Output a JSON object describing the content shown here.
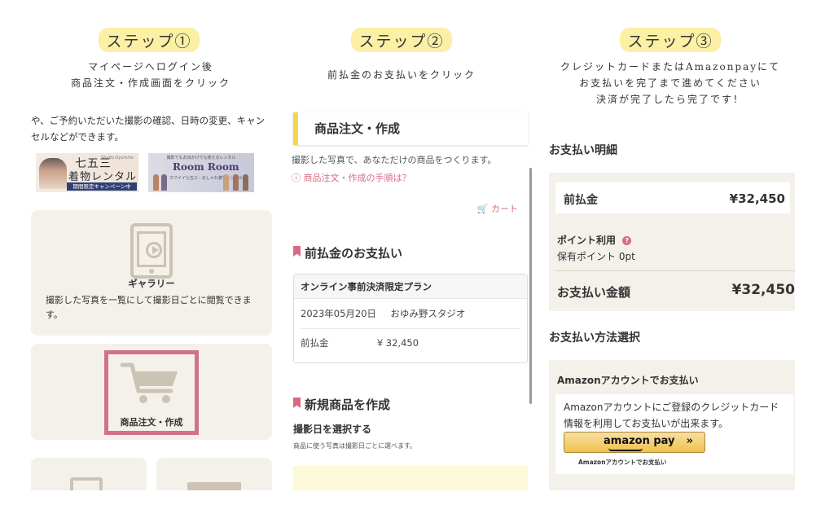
{
  "steps": [
    {
      "badge": "ステップ①",
      "note_lines": [
        "マイページへログイン後",
        "商品注文・作成画面をクリック"
      ]
    },
    {
      "badge": "ステップ②",
      "note_lines": [
        "前払金のお支払いをクリック"
      ]
    },
    {
      "badge": "ステップ③",
      "note_lines": [
        "クレジットカードまたはAmazonpayにて",
        "お支払いを完了まで進めてください",
        "決済が完了したら完了です！"
      ]
    }
  ],
  "panel1": {
    "intro": "や、ご予約いただいた撮影の確認、日時の変更、キャンセルなどができます。",
    "banner_shichigosan": {
      "brand": "Studio Oyumino",
      "title1": "七五三",
      "title2": "着物レンタル",
      "campaign": "期間限定キャンペーン中"
    },
    "banner_roomroom": {
      "top": "撮影でもお出かけでも使えるレンタル",
      "logo": "Room Room",
      "sub": "カワイイ七五三・おしゃれ着物レンタル"
    },
    "gallery": {
      "title": "ギャラリー",
      "desc": "撮影した写真を一覧にして撮影日ごとに閲覧できます。"
    },
    "order": {
      "label": "商品注文・作成"
    }
  },
  "panel2": {
    "header": "商品注文・作成",
    "desc": "撮影した写真で、あなただけの商品をつくります。",
    "howto_link": "ⓘ 商品注文・作成の手順は？",
    "cart_link": "カート",
    "prepay_title": "前払金のお支払い",
    "plan": {
      "name": "オンライン事前決済限定プラン",
      "date": "2023年05月20日",
      "studio": "おゆみ野スタジオ",
      "fee_label": "前払金",
      "fee_value": "¥ 32,450"
    },
    "new_title": "新規商品を作成",
    "select_date": "撮影日を選択する",
    "select_note": "商品に使う写真は撮影日ごとに選べます。"
  },
  "panel3": {
    "detail_title": "お支払い明細",
    "prepay_label": "前払金",
    "prepay_value": "¥32,450",
    "points_label": "ポイント利用",
    "points_held": "保有ポイント 0pt",
    "total_label": "お支払い金額",
    "total_value": "¥32,450",
    "method_title": "お支払い方法選択",
    "amazon_head": "Amazonアカウントでお支払い",
    "amazon_text": "Amazonアカウントにご登録のクレジットカード情報を利用してお支払いが出来ます。",
    "amazon_btn": "amazon pay",
    "amazon_arrows": "»",
    "amazon_caption": "Amazonアカウントでお支払い"
  },
  "colors": {
    "badge": "#fbf0a4",
    "accent_pink": "#d86a84",
    "highlight": "#d4708b",
    "card_beige": "#f4f1ea",
    "header_yellow": "#f6d54a"
  }
}
